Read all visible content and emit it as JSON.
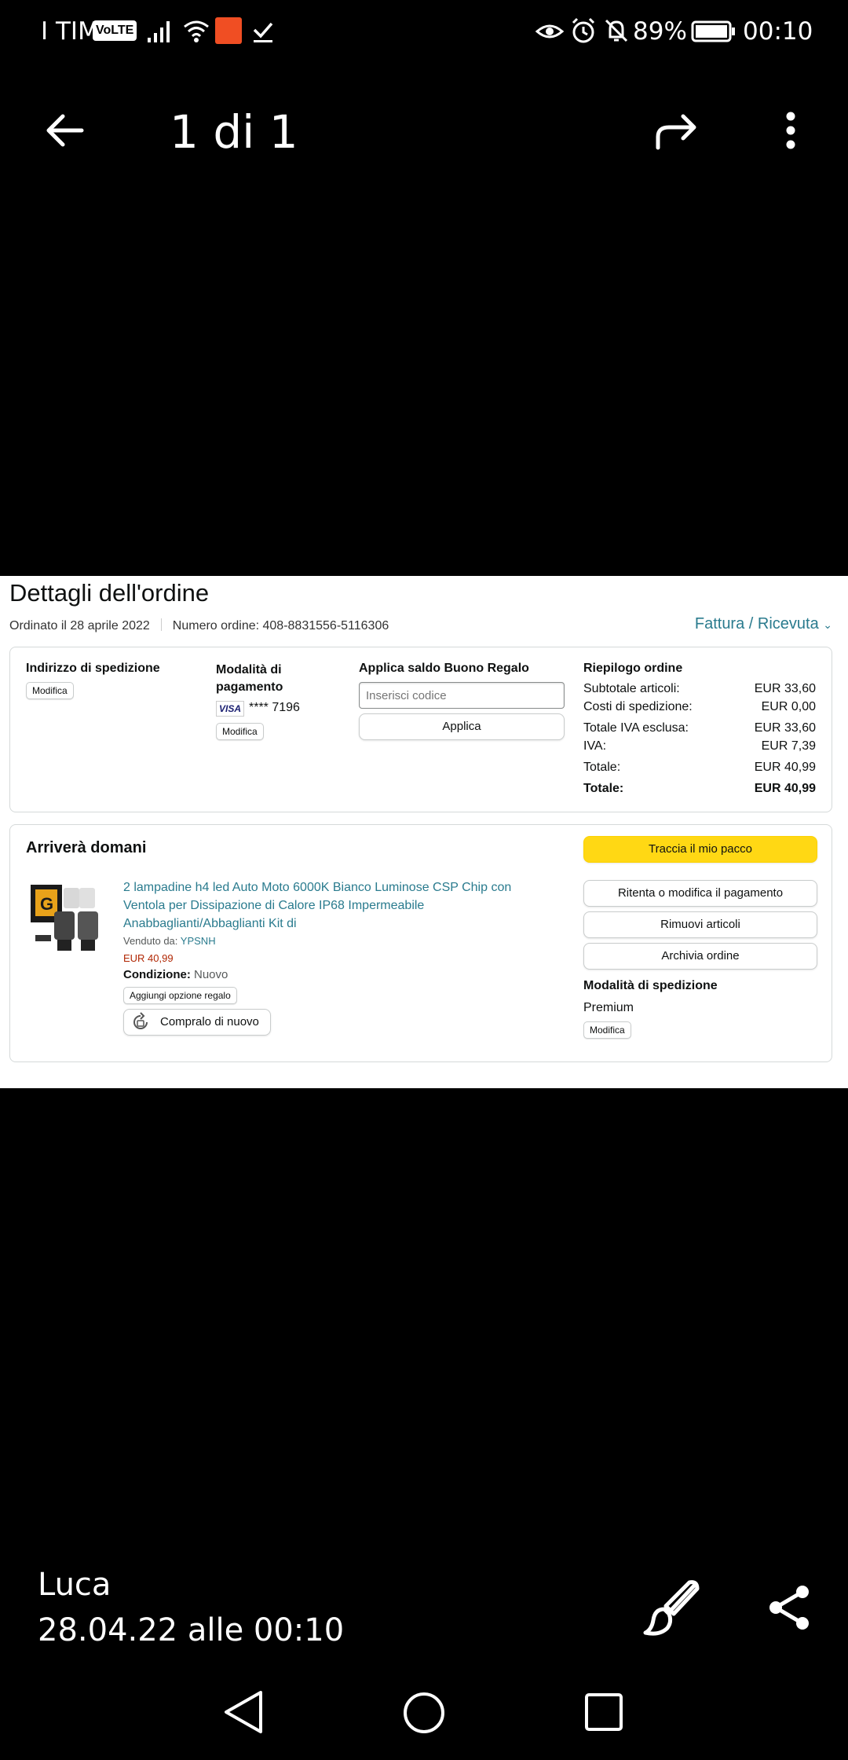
{
  "status_bar": {
    "carrier": "I TIM",
    "volte": "VoLTE",
    "battery_pct": "89%",
    "clock": "00:10"
  },
  "viewer": {
    "title": "1 di 1",
    "sender": "Luca",
    "date": "28.04.22 alle 00:10"
  },
  "order": {
    "title": "Dettagli dell'ordine",
    "ordered_on": "Ordinato il 28 aprile 2022",
    "order_number": "Numero ordine: 408-8831556-5116306",
    "invoice_link": "Fattura / Ricevuta",
    "shipping_address_label": "Indirizzo di spedizione",
    "modify": "Modifica",
    "payment_label": "Modalità di pagamento",
    "card_brand": "VISA",
    "card_digits": "**** 7196",
    "gift_label": "Applica saldo Buono Regalo",
    "gift_placeholder": "Inserisci codice",
    "apply": "Applica",
    "summary": {
      "title": "Riepilogo ordine",
      "rows": [
        {
          "label": "Subtotale articoli:",
          "value": "EUR 33,60"
        },
        {
          "label": "Costi di spedizione:",
          "value": "EUR 0,00"
        },
        {
          "label": "Totale IVA esclusa:",
          "value": "EUR 33,60"
        },
        {
          "label": "IVA:",
          "value": "EUR 7,39"
        },
        {
          "label": "Totale:",
          "value": "EUR 40,99"
        },
        {
          "label": "Totale:",
          "value": "EUR 40,99"
        }
      ]
    },
    "shipment": {
      "heading": "Arriverà domani",
      "product_title": "2 lampadine h4 led Auto Moto 6000K Bianco Luminose CSP Chip con Ventola per Dissipazione di Calore IP68 Impermeabile Anabbaglianti/Abbaglianti Kit di",
      "sold_by_label": "Venduto da:",
      "seller": "YPSNH",
      "price": "EUR 40,99",
      "condition_label": "Condizione:",
      "condition": "Nuovo",
      "gift_option": "Aggiungi opzione regalo",
      "buy_again": "Compralo di nuovo",
      "track": "Traccia il mio pacco",
      "retry_payment": "Ritenta o modifica il pagamento",
      "remove_items": "Rimuovi articoli",
      "archive": "Archivia ordine",
      "ship_mode_label": "Modalità di spedizione",
      "ship_mode": "Premium",
      "modify": "Modifica"
    }
  },
  "colors": {
    "accent_link": "#2a7b8e",
    "track_button": "#ffd814",
    "price": "#b12704"
  }
}
